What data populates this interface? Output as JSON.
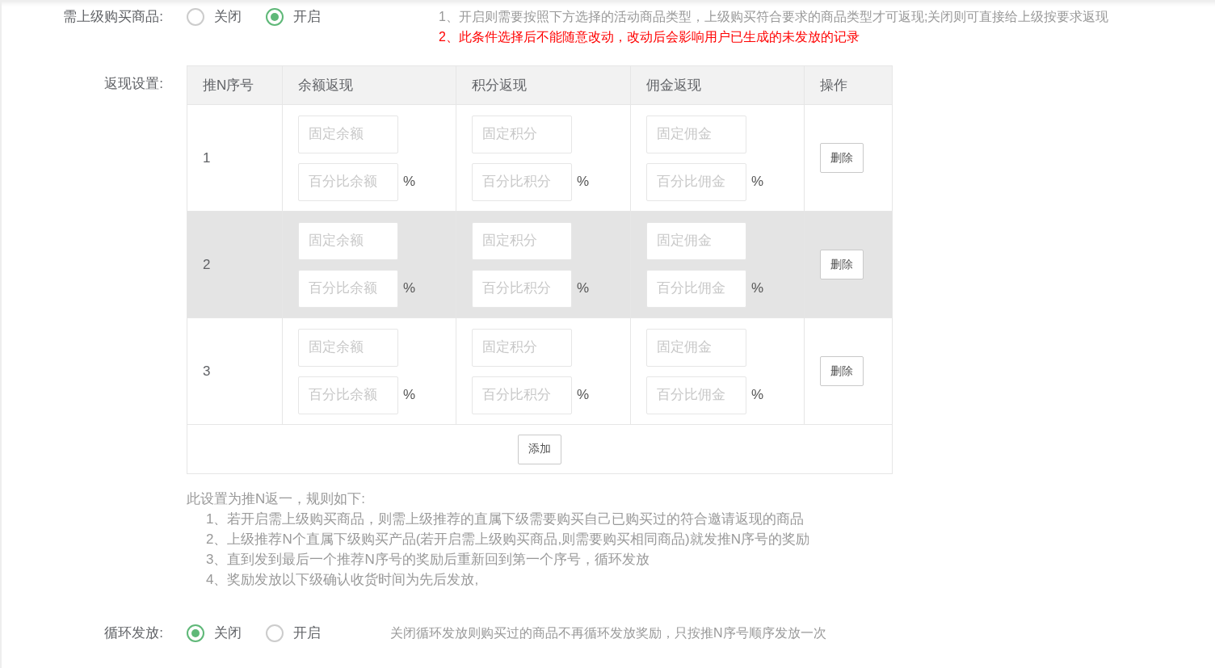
{
  "require_purchase": {
    "label": "需上级购买商品:",
    "options": [
      {
        "label": "关闭",
        "selected": false
      },
      {
        "label": "开启",
        "selected": true
      }
    ],
    "hints": [
      {
        "text": "1、开启则需要按照下方选择的活动商品类型，上级购买符合要求的商品类型才可返现;关闭则可直接给上级按要求返现",
        "kind": "info"
      },
      {
        "text": "2、此条件选择后不能随意改动，改动后会影响用户已生成的未发放的记录",
        "kind": "warning"
      }
    ]
  },
  "cashback": {
    "label": "返现设置:",
    "columns": [
      "推N序号",
      "余额返现",
      "积分返现",
      "佣金返现",
      "操作"
    ],
    "rows": [
      {
        "index": "1",
        "highlighted": false,
        "fields": [
          {
            "fixed_placeholder": "固定余额",
            "percent_placeholder": "百分比余额",
            "unit": "%"
          },
          {
            "fixed_placeholder": "固定积分",
            "percent_placeholder": "百分比积分",
            "unit": "%"
          },
          {
            "fixed_placeholder": "固定佣金",
            "percent_placeholder": "百分比佣金",
            "unit": "%"
          }
        ],
        "action": "删除"
      },
      {
        "index": "2",
        "highlighted": true,
        "fields": [
          {
            "fixed_placeholder": "固定余额",
            "percent_placeholder": "百分比余额",
            "unit": "%"
          },
          {
            "fixed_placeholder": "固定积分",
            "percent_placeholder": "百分比积分",
            "unit": "%"
          },
          {
            "fixed_placeholder": "固定佣金",
            "percent_placeholder": "百分比佣金",
            "unit": "%"
          }
        ],
        "action": "删除"
      },
      {
        "index": "3",
        "highlighted": false,
        "fields": [
          {
            "fixed_placeholder": "固定余额",
            "percent_placeholder": "百分比余额",
            "unit": "%"
          },
          {
            "fixed_placeholder": "固定积分",
            "percent_placeholder": "百分比积分",
            "unit": "%"
          },
          {
            "fixed_placeholder": "固定佣金",
            "percent_placeholder": "百分比佣金",
            "unit": "%"
          }
        ],
        "action": "删除"
      }
    ],
    "add_button": "添加",
    "notes_title": "此设置为推N返一，规则如下:",
    "notes": [
      "1、若开启需上级购买商品，则需上级推荐的直属下级需要购买自己已购买过的符合邀请返现的商品",
      "2、上级推荐N个直属下级购买产品(若开启需上级购买商品,则需要购买相同商品)就发推N序号的奖励",
      "3、直到发到最后一个推荐N序号的奖励后重新回到第一个序号，循环发放",
      "4、奖励发放以下级确认收货时间为先后发放,"
    ]
  },
  "cycle": {
    "label": "循环发放:",
    "options": [
      {
        "label": "关闭",
        "selected": true
      },
      {
        "label": "开启",
        "selected": false
      }
    ],
    "hint": "关闭循环发放则购买过的商品不再循环发放奖励，只按推N序号顺序发放一次"
  }
}
